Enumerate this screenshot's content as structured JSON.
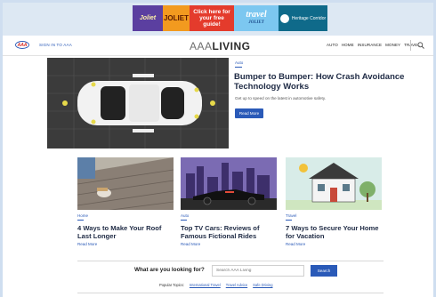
{
  "ad": {
    "seg1": "Joliet",
    "seg2": "JOLIET",
    "seg3": "Click here for your free guide!",
    "seg4_main": "travel",
    "seg4_sub": "JOLIET",
    "seg5": "Heritage Corridor"
  },
  "nav": {
    "signin": "SIGN IN TO AAA",
    "brand_left": "AAA",
    "brand_right": "LIVING",
    "menu": [
      "AUTO",
      "HOME",
      "INSURANCE",
      "MONEY",
      "TRAVEL"
    ]
  },
  "hero": {
    "tag": "Auto",
    "title": "Bumper to Bumper: How Crash Avoidance Technology Works",
    "subtitle": "Get up to speed on the latest in automotive safety.",
    "button": "Read More"
  },
  "cards": [
    {
      "tag": "Home",
      "title": "4 Ways to Make Your Roof Last Longer",
      "more": "Read More"
    },
    {
      "tag": "Auto",
      "title": "Top TV Cars: Reviews of Famous Fictional Rides",
      "more": "Read More"
    },
    {
      "tag": "Travel",
      "title": "7 Ways to Secure Your Home for Vacation",
      "more": "Read More"
    }
  ],
  "search": {
    "label": "What are you looking for?",
    "placeholder": "Search AAA Living",
    "button": "Search",
    "popular_label": "Popular Topics:",
    "topics": [
      "International Travel",
      "Travel Advice",
      "Safe Driving"
    ]
  },
  "colors": {
    "accent": "#2a5ab8",
    "heading": "#1e2a44",
    "page_bg": "#dde8f3"
  }
}
